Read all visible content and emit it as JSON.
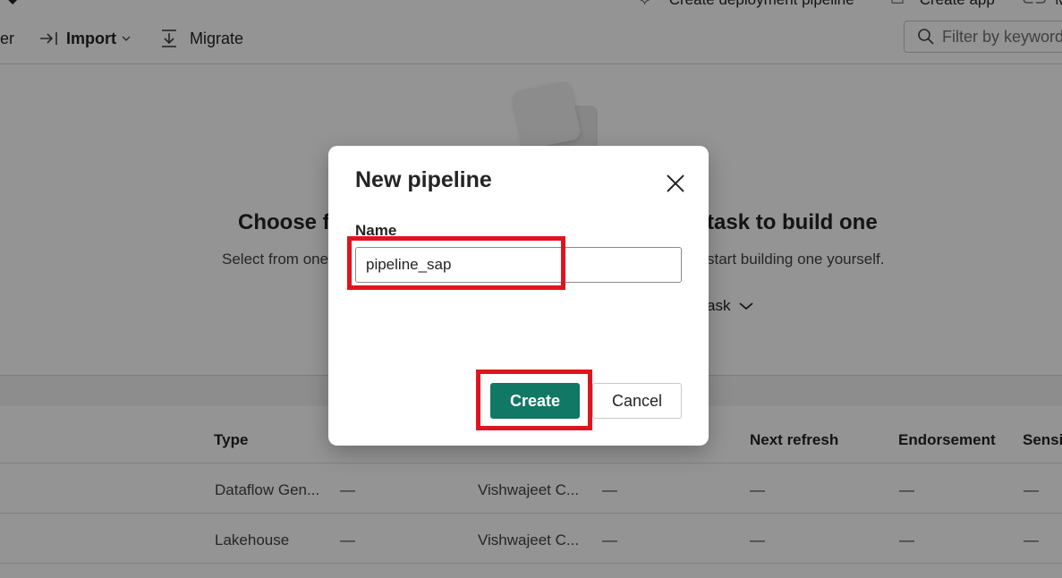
{
  "topbar": {
    "create_deployment_pipeline": "Create deployment pipeline",
    "create_app": "Create app",
    "more_label": "M"
  },
  "toolbar": {
    "truncated_item": "er",
    "import_label": "Import",
    "migrate_label": "Migrate",
    "filter_placeholder": "Filter by keyword"
  },
  "empty_state": {
    "title_left": "Choose f",
    "title_right": "task to build one",
    "subtitle_left": "Select from one",
    "subtitle_right": "start building one yourself.",
    "task_link": "ask"
  },
  "table": {
    "headers": [
      "Type",
      "Next refresh",
      "Endorsement",
      "Sensit"
    ],
    "rows": [
      {
        "type": "Dataflow Gen...",
        "c2": "—",
        "owner": "Vishwajeet C...",
        "c4": "—",
        "next_refresh": "—",
        "endorsement": "—",
        "sensitivity": "—"
      },
      {
        "type": "Lakehouse",
        "c2": "—",
        "owner": "Vishwajeet C...",
        "c4": "—",
        "next_refresh": "—",
        "endorsement": "—",
        "sensitivity": "—"
      }
    ]
  },
  "dialog": {
    "title": "New pipeline",
    "name_label": "Name",
    "name_value": "pipeline_sap",
    "create_label": "Create",
    "cancel_label": "Cancel"
  },
  "colors": {
    "primary_button": "#117865",
    "highlight": "#e0141e"
  }
}
